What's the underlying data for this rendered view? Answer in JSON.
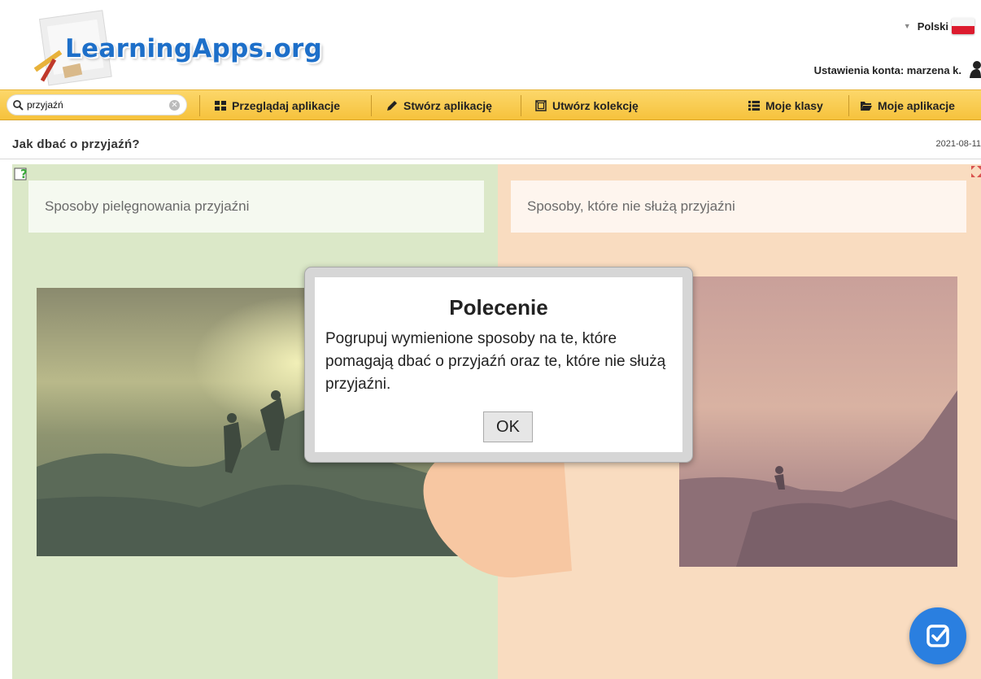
{
  "header": {
    "logo": "LearningApps.org",
    "language": "Polski",
    "account_label": "Ustawienia konta: marzena k."
  },
  "navbar": {
    "search_value": "przyjaźń",
    "items": [
      {
        "label": "Przeglądaj aplikacje",
        "icon": "grid-icon"
      },
      {
        "label": "Stwórz aplikację",
        "icon": "pencil-icon"
      },
      {
        "label": "Utwórz kolekcję",
        "icon": "collection-icon"
      },
      {
        "label": "Moje klasy",
        "icon": "list-icon"
      },
      {
        "label": "Moje aplikacje",
        "icon": "folder-icon"
      }
    ]
  },
  "page": {
    "title": "Jak dbać o przyjaźń?",
    "date": "2021-08-11"
  },
  "app": {
    "left_category": "Sposoby pielęgnowania przyjaźni",
    "right_category": "Sposoby, które nie służą przyjaźni",
    "colors": {
      "left": "#dbe8c8",
      "right": "#f9dcc0",
      "check_button": "#2a7fe0"
    }
  },
  "dialog": {
    "title": "Polecenie",
    "text": "Pogrupuj wymienione sposoby na te, które pomagają dbać o przyjaźń oraz te, które nie służą przyjaźni.",
    "ok_label": "OK"
  }
}
